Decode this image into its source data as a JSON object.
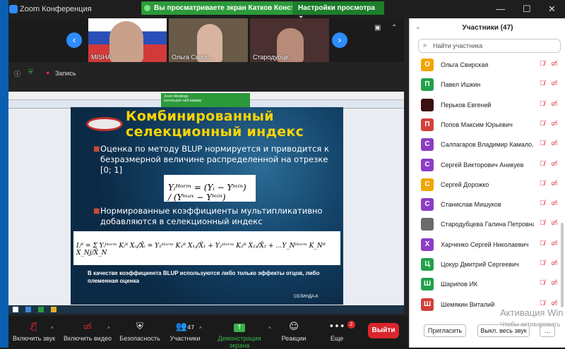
{
  "window": {
    "title": "Zoom Конференция"
  },
  "banner": {
    "text": "Вы просматриваете экран Катков Константин",
    "view_options": "Настройки просмотра ⌄"
  },
  "window_controls": {
    "minimize": "—",
    "maximize": "☐",
    "close": "✕"
  },
  "video_strip": {
    "tiles": [
      {
        "name": "MISHA"
      },
      {
        "name": "Ольга Свирс..."
      },
      {
        "name": "Стародубце..."
      }
    ]
  },
  "recording": {
    "label": "Запись"
  },
  "slide": {
    "title_line1": "Комбинированный",
    "title_line2": "селекционный индекс",
    "bullet1": "Оценка по методу BLUP нормируется и приводится к безразмерной величине распределенной на отрезке [0; 1]",
    "bullet2": "Нормированные коэффициенты мультипликативно добавляются в селекционный индекс",
    "formula1": "Yᵢᴴᵒʳᵐ = (Yᵢ − Yᵐⁱⁿ) / (Yᵐᵃˣ − Yᵐⁱⁿ)",
    "formula2": "Iⱼᴿ = Σ Yᵢᴴᵒʳᵐ Kᵢᴿ Xᵢⱼ/X̄ᵢ = Y₁ᴴᵒʳᵐ K₁ᴿ X₁ⱼ/X̄₁ + Y₂ᴴᵒʳᵐ K₂ᴿ X₂ⱼ/X̄₂ + …Y_Nᴴᵒʳᵐ K_Nᴿ X_Nj/X̄_N",
    "note": "В качестве коэффициента BLUP используются либо только эффекты отцов, либо племенная оценка",
    "footer": "СЕЛИНДА-К"
  },
  "shared_popup": {
    "line1": "Zoom Meetings",
    "line2": "использует веб-камеру"
  },
  "toolbar": {
    "mute": "Включить звук",
    "video": "Включить видео",
    "security": "Безопасность",
    "participants": "Участники",
    "participants_count": "47",
    "share": "Демонстрация экрана",
    "reactions": "Реакции",
    "more": "Еще",
    "more_badge": "2",
    "leave": "Выйти"
  },
  "panel": {
    "title": "Участники (47)",
    "search_placeholder": "Найти участника",
    "participants": [
      {
        "initial": "О",
        "name": "Ольга Свирская",
        "color": "#f0a500"
      },
      {
        "initial": "П",
        "name": "Павел Ишкин",
        "color": "#22a04a"
      },
      {
        "initial": "",
        "name": "Перьков Евгений",
        "color": "#3a1010"
      },
      {
        "initial": "П",
        "name": "Попов Максим Юрьевич",
        "color": "#d2403a"
      },
      {
        "initial": "С",
        "name": "Салпагаров Владимир Камало...",
        "color": "#8b3dc4"
      },
      {
        "initial": "С",
        "name": "Сергей Викторович Аникуев",
        "color": "#8b3dc4"
      },
      {
        "initial": "С",
        "name": "Сергей Дорожко",
        "color": "#f0a500"
      },
      {
        "initial": "С",
        "name": "Станислав Мишуков",
        "color": "#8b3dc4"
      },
      {
        "initial": "",
        "name": "Стародубцева Галина Петровна",
        "color": "#6b6b6b"
      },
      {
        "initial": "Х",
        "name": "Харченко Сергей Николаевич",
        "color": "#8b3dc4"
      },
      {
        "initial": "Ц",
        "name": "Цокур Дмитрий Сергеевич",
        "color": "#22a04a"
      },
      {
        "initial": "Ш",
        "name": "Шарипов ИК",
        "color": "#22a04a"
      },
      {
        "initial": "Ш",
        "name": "Шемякин Виталий",
        "color": "#d2403a"
      }
    ],
    "invite": "Пригласить",
    "mute_all": "Выкл. весь звук",
    "more": "…"
  },
  "watermark": {
    "line1": "Активация Win",
    "line2": "Чтобы активировать"
  }
}
